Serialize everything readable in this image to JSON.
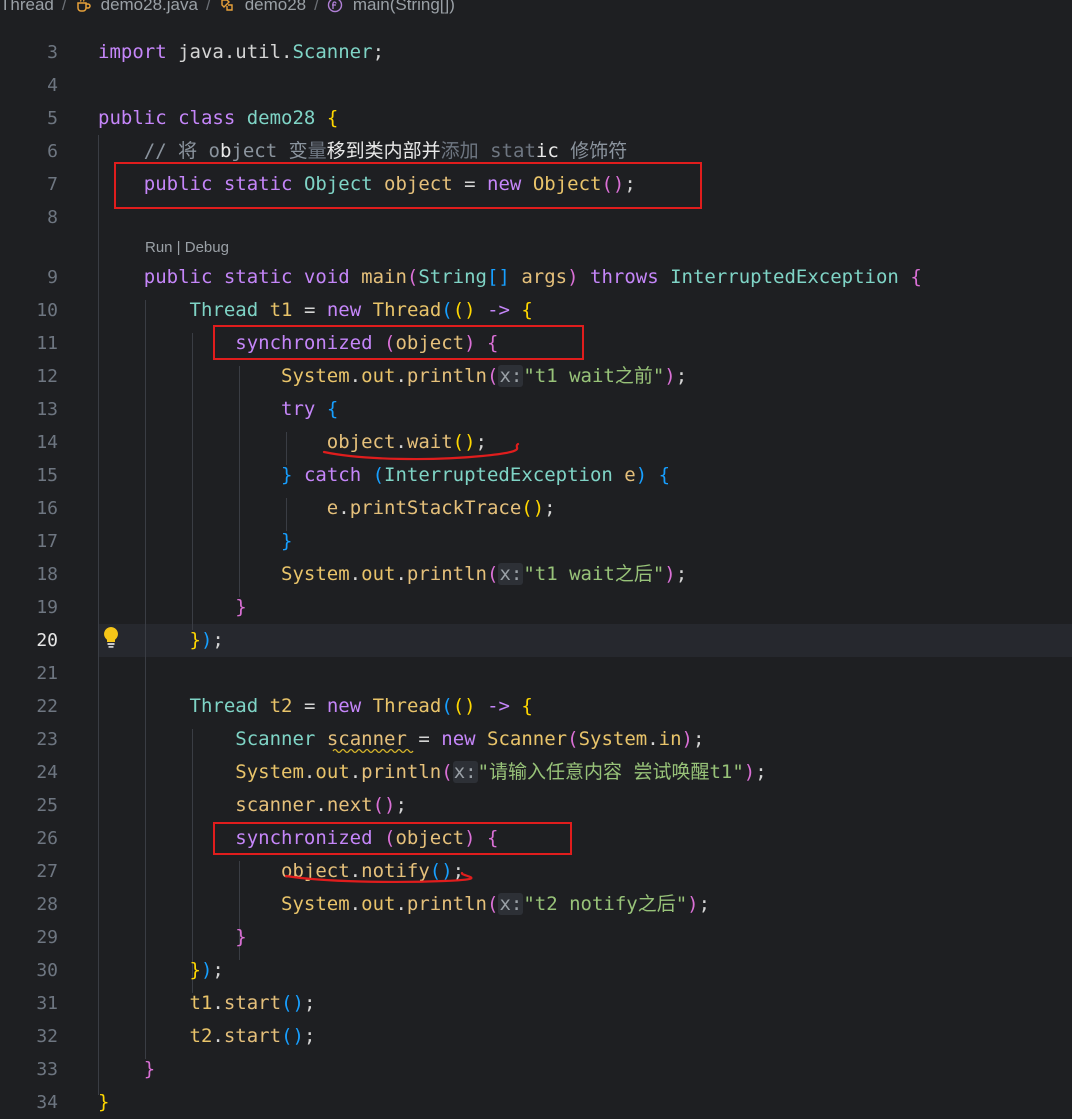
{
  "breadcrumb": {
    "items": [
      {
        "label": "Thread",
        "icon": "folder-icon"
      },
      {
        "label": "demo28.java",
        "icon": "java-file-icon"
      },
      {
        "label": "demo28",
        "icon": "class-icon"
      },
      {
        "label": "main(String[])",
        "icon": "method-icon"
      }
    ]
  },
  "editor": {
    "active_line": "20",
    "codelens": "Run | Debug",
    "line_numbers": [
      "3",
      "4",
      "5",
      "6",
      "7",
      "8",
      "9",
      "10",
      "11",
      "12",
      "13",
      "14",
      "15",
      "16",
      "17",
      "18",
      "19",
      "20",
      "21",
      "22",
      "23",
      "24",
      "25",
      "26",
      "27",
      "28",
      "29",
      "30",
      "31",
      "32",
      "33",
      "34"
    ],
    "annotations": {
      "boxed_lines": [
        "7",
        "11",
        "26"
      ],
      "underlined_lines": [
        "14",
        "27"
      ]
    },
    "colors": {
      "background": "#1e1f22",
      "annotation_red": "#e01d1d"
    }
  }
}
